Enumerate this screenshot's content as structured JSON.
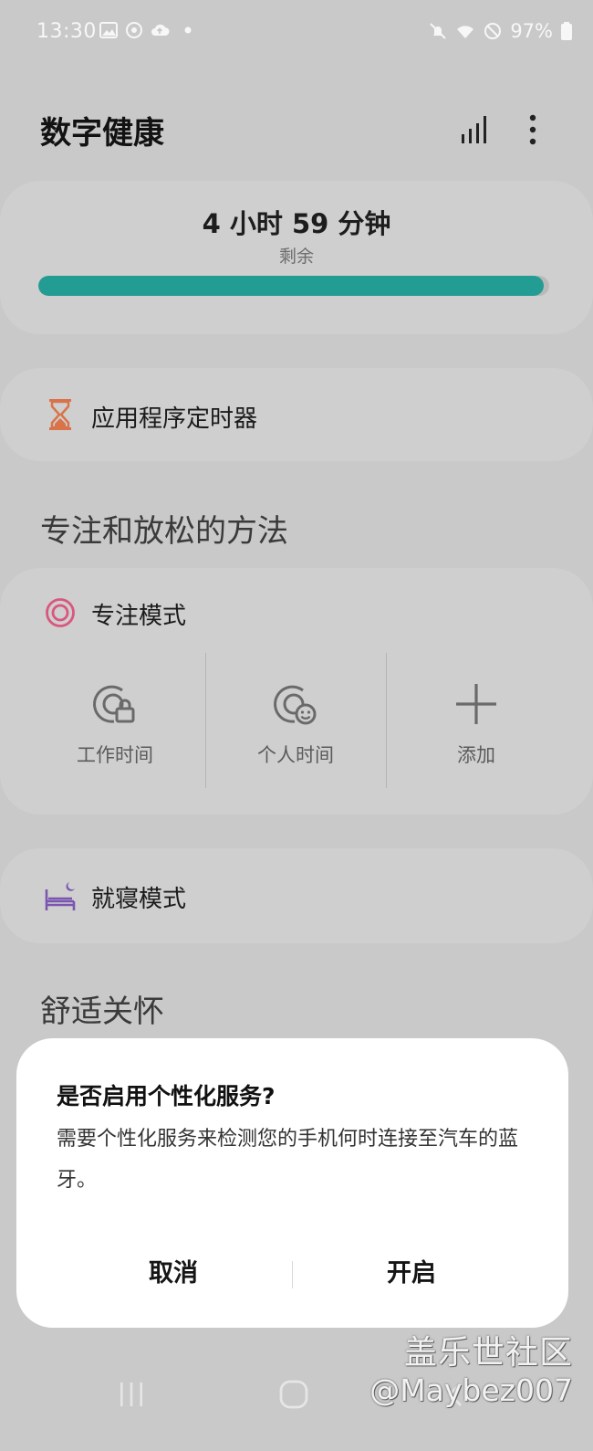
{
  "status_bar": {
    "time": "13:30",
    "battery": "97%"
  },
  "header": {
    "title": "数字健康"
  },
  "remaining": {
    "time": "4 小时 59 分钟",
    "label": "剩余",
    "progress_fraction": 0.99,
    "progress_color": "#239d94"
  },
  "app_timer": {
    "label": "应用程序定时器",
    "icon": "hourglass-icon",
    "icon_color": "#d9734a"
  },
  "focus_section": {
    "title": "专注和放松的方法",
    "focus_mode": {
      "label": "专注模式",
      "icon_color": "#d9577e",
      "items": [
        {
          "label": "工作时间",
          "icon": "work-time-icon"
        },
        {
          "label": "个人时间",
          "icon": "personal-time-icon"
        },
        {
          "label": "添加",
          "icon": "plus-icon"
        }
      ]
    },
    "bedtime_mode": {
      "label": "就寝模式",
      "icon_color": "#7a56b0"
    }
  },
  "wellbeing_section": {
    "title": "舒适关怀"
  },
  "dialog": {
    "title": "是否启用个性化服务?",
    "body": "需要个性化服务来检测您的手机何时连接至汽车的蓝牙。",
    "cancel": "取消",
    "confirm": "开启"
  },
  "watermark": {
    "line1": "盖乐世社区",
    "line2": "@Maybez007"
  }
}
